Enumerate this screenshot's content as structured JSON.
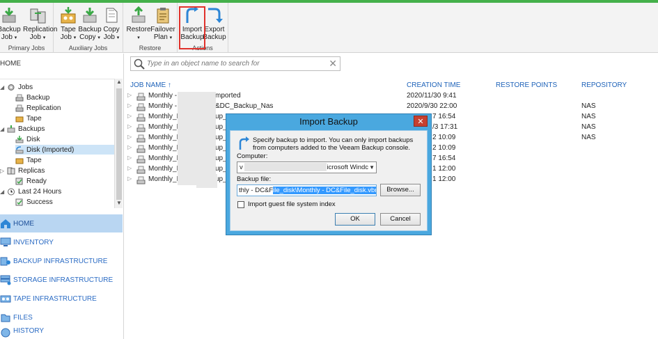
{
  "ribbon": {
    "groups": [
      {
        "label": "Primary Jobs",
        "buttons": [
          {
            "label1": "Backup",
            "label2": "Job",
            "dropdown": true
          },
          {
            "label1": "Replication",
            "label2": "Job",
            "dropdown": true
          }
        ]
      },
      {
        "label": "Auxiliary Jobs",
        "buttons": [
          {
            "label1": "Tape",
            "label2": "Job",
            "dropdown": true
          },
          {
            "label1": "Backup",
            "label2": "Copy",
            "dropdown": true
          },
          {
            "label1": "Copy",
            "label2": "Job",
            "dropdown": true
          }
        ]
      },
      {
        "label": "Restore",
        "buttons": [
          {
            "label1": "Restore",
            "label2": "",
            "dropdown": true
          },
          {
            "label1": "Failover",
            "label2": "Plan",
            "dropdown": true
          }
        ]
      },
      {
        "label": "Actions",
        "buttons": [
          {
            "label1": "Import",
            "label2": "Backup",
            "dropdown": false
          },
          {
            "label1": "Export",
            "label2": "Backup",
            "dropdown": false
          }
        ]
      }
    ],
    "dropdown_glyph": "▾"
  },
  "left": {
    "home_title": "HOME",
    "tree": [
      {
        "label": "Jobs",
        "toggle": "◢"
      },
      {
        "label": "Backup",
        "toggle": ""
      },
      {
        "label": "Replication",
        "toggle": ""
      },
      {
        "label": "Tape",
        "toggle": ""
      },
      {
        "label": "Backups",
        "toggle": "◢"
      },
      {
        "label": "Disk",
        "toggle": ""
      },
      {
        "label": "Disk (Imported)",
        "toggle": ""
      },
      {
        "label": "Tape",
        "toggle": ""
      },
      {
        "label": "Replicas",
        "toggle": "▷"
      },
      {
        "label": "Ready",
        "toggle": ""
      },
      {
        "label": "Last 24 Hours",
        "toggle": "◢"
      },
      {
        "label": "Success",
        "toggle": ""
      }
    ],
    "sections": [
      "HOME",
      "INVENTORY",
      "BACKUP INFRASTRUCTURE",
      "STORAGE INFRASTRUCTURE",
      "TAPE INFRASTRUCTURE",
      "FILES",
      "HISTORY"
    ]
  },
  "search": {
    "placeholder": "Type in an object name to search for"
  },
  "table": {
    "headers": {
      "name": "JOB NAME",
      "sort": "↑",
      "created": "CREATION TIME",
      "points": "RESTORE POINTS",
      "repo": "REPOSITORY"
    },
    "rows": [
      {
        "name": "Monthly - ",
        "tail": "mported",
        "created": "2020/11/30 9:41",
        "repo": ""
      },
      {
        "name": "Monthly - ",
        "tail": "&DC_Backup_Nas",
        "created": "2020/9/30 22:00",
        "repo": "NAS"
      },
      {
        "name": "Monthly_E",
        "tail": "up_",
        "created": "7 16:54",
        "repo": "NAS"
      },
      {
        "name": "Monthly_E",
        "tail": "up_",
        "created": "/3 17:31",
        "repo": "NAS"
      },
      {
        "name": "Monthly_E",
        "tail": "up_",
        "created": "2 10:09",
        "repo": "NAS"
      },
      {
        "name": "Monthly_E",
        "tail": "up_",
        "created": "2 10:09",
        "repo": ""
      },
      {
        "name": "Monthly_E",
        "tail": "up_",
        "created": "7 16:54",
        "repo": ""
      },
      {
        "name": "Monthly_E",
        "tail": "up_",
        "created": "1 12:00",
        "repo": ""
      },
      {
        "name": "Monthly_L",
        "tail": "up_",
        "created": "1 12:00",
        "repo": ""
      }
    ]
  },
  "dialog": {
    "title": "Import Backup",
    "close": "✕",
    "description": "Specify backup to import. You can only import backups from computers added to the Veeam Backup console.",
    "computer_label": "Computer:",
    "computer_value_start": "v",
    "computer_value_end": "icrosoft Windc",
    "backup_file_label": "Backup file:",
    "backup_file_prefix": "thly - DC&F",
    "backup_file_selected": "ile_disk\\Monthly - DC&File_disk.vbm",
    "browse_label": "Browse...",
    "import_index_label": "Import guest file system index",
    "ok_label": "OK",
    "cancel_label": "Cancel"
  },
  "colors": {
    "accent_green": "#44b04a",
    "link_blue": "#1f63b9",
    "dialog_frame": "#4aa8df",
    "highlight_red": "#e0312b"
  }
}
